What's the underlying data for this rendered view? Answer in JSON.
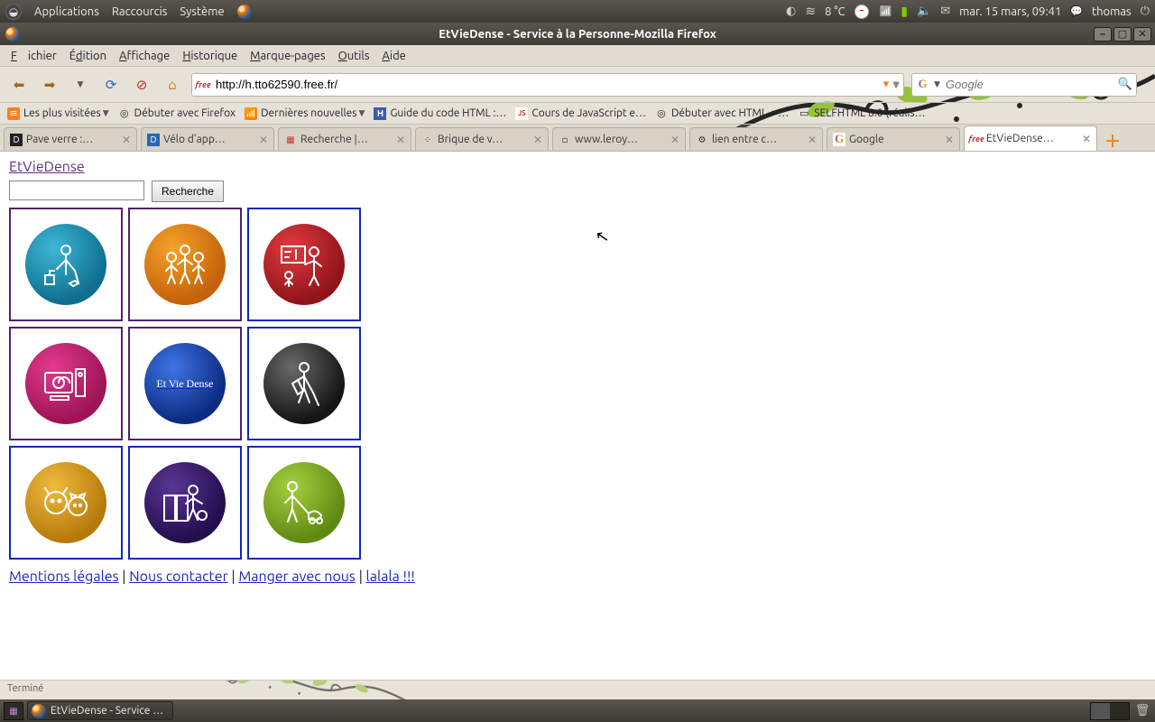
{
  "gnome": {
    "apps": "Applications",
    "quick": "Raccourcis",
    "sys": "Système",
    "weather": "8 °C",
    "clock": "mar. 15 mars, 09:41",
    "user": "thomas"
  },
  "ff": {
    "title": "EtVieDense - Service à la Personne-Mozilla Firefox",
    "menu": [
      "Fichier",
      "Édition",
      "Affichage",
      "Historique",
      "Marque-pages",
      "Outils",
      "Aide"
    ],
    "url": "http://h.tto62590.free.fr/",
    "search_placeholder": "Google",
    "bookmarks": [
      {
        "label": "Les plus visitées",
        "type": "folder",
        "icon": "rss-like",
        "dd": true
      },
      {
        "label": "Débuter avec Firefox",
        "type": "link",
        "icon": "doc"
      },
      {
        "label": "Dernières nouvelles",
        "type": "folder",
        "icon": "rss",
        "dd": true
      },
      {
        "label": "Guide du code HTML :…",
        "type": "link",
        "icon": "h"
      },
      {
        "label": "Cours de JavaScript e…",
        "type": "link",
        "icon": "js"
      },
      {
        "label": "Débuter avec HTML + …",
        "type": "link",
        "icon": "doc"
      },
      {
        "label": "SELFHTML 8.0 (réalis…",
        "type": "link",
        "icon": "plain"
      }
    ],
    "tabs": [
      {
        "label": "Pave verre :…",
        "active": false,
        "icon": "d"
      },
      {
        "label": "Vélo d'app…",
        "active": false,
        "icon": "d2"
      },
      {
        "label": "Recherche |…",
        "active": false,
        "icon": "lm"
      },
      {
        "label": "Brique de v…",
        "active": false,
        "icon": "dots"
      },
      {
        "label": "www.leroy…",
        "active": false,
        "icon": "page"
      },
      {
        "label": "lien entre c…",
        "active": false,
        "icon": "gear"
      },
      {
        "label": "Google",
        "active": false,
        "icon": "g"
      },
      {
        "label": "EtVieDense…",
        "active": true,
        "icon": "free"
      }
    ],
    "status": "Terminé"
  },
  "page": {
    "title": "EtVieDense",
    "search_btn": "Recherche",
    "tiles": [
      {
        "border": "purple",
        "color": "#1486ab",
        "icon": "cleaner"
      },
      {
        "border": "purple",
        "color": "#db7a13",
        "icon": "children"
      },
      {
        "border": "blue",
        "color": "#b31c23",
        "icon": "teacher"
      },
      {
        "border": "purple",
        "color": "#c1206d",
        "icon": "computer"
      },
      {
        "border": "purple",
        "color": "#173f9e",
        "icon": "logo",
        "text": "Et Vie Dense"
      },
      {
        "border": "blue",
        "color": "#2f2f2f",
        "icon": "gardener"
      },
      {
        "border": "blue",
        "color": "#d19314",
        "icon": "pets"
      },
      {
        "border": "blue",
        "color": "#3a1a6a",
        "icon": "office"
      },
      {
        "border": "blue",
        "color": "#7ead1b",
        "icon": "mower"
      }
    ],
    "links": [
      "Mentions légales",
      "Nous contacter",
      "Manger avec nous",
      "lalala !!!"
    ]
  },
  "taskbar": {
    "task": "EtVieDense - Service …"
  }
}
